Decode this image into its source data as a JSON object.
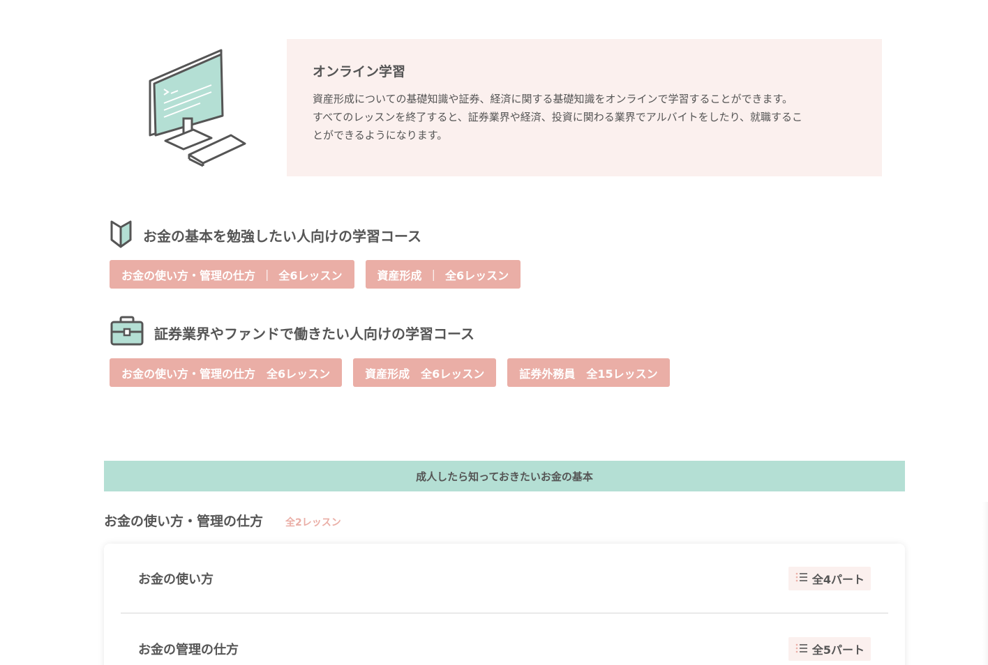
{
  "intro": {
    "title": "オンライン学習",
    "lines": [
      "資産形成についての基礎知識や証券、経済に関する基礎知識をオンラインで学習することができます。",
      "すべてのレッスンを終了すると、証券業界や経済、投資に関わる業界でアルバイトをしたり、就職するこ",
      "とができるようになります。"
    ]
  },
  "courses": [
    {
      "title": "お金の基本を勉強したい人向けの学習コース",
      "icon": "beginner-leaf-icon",
      "chips": [
        {
          "name": "お金の使い方・管理の仕方",
          "sep": "|",
          "count": "全6レッスン"
        },
        {
          "name": "資産形成",
          "sep": "|",
          "count": "全6レッスン"
        }
      ]
    },
    {
      "title": "証券業界やファンドで働きたい人向けの学習コース",
      "icon": "briefcase-icon",
      "chips": [
        {
          "name": "お金の使い方・管理の仕方",
          "count": "全6レッスン"
        },
        {
          "name": "資産形成",
          "count": "全6レッスン"
        },
        {
          "name": "証券外務員",
          "count": "全15レッスン"
        }
      ]
    }
  ],
  "section": {
    "title": "成人したら知っておきたいお金の基本",
    "sub_title": "お金の使い方・管理の仕方",
    "sub_count": "全2レッスン",
    "lessons": [
      {
        "name": "お金の使い方",
        "parts": "全4パート",
        "icon": "list-icon"
      },
      {
        "name": "お金の管理の仕方",
        "parts": "全5パート",
        "icon": "list-icon"
      }
    ]
  },
  "colors": {
    "accent_pink": "#eaaea6",
    "accent_mint": "#b4dfd4",
    "intro_bg": "#fbf0ee",
    "text": "#555555"
  }
}
